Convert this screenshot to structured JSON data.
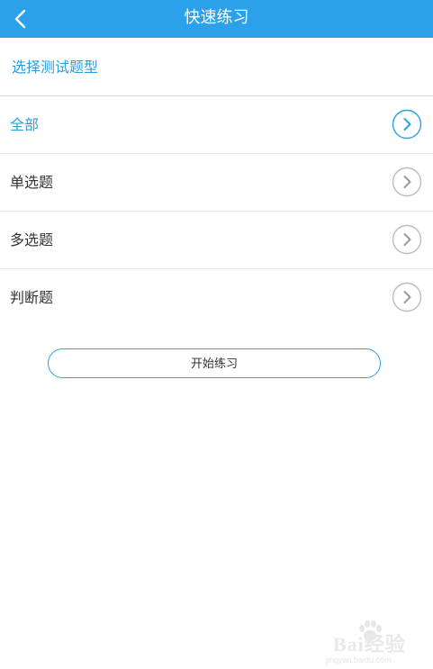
{
  "header": {
    "title": "快速练习",
    "back_icon": "back-arrow-icon",
    "bg_color": "#2aa1e9"
  },
  "section": {
    "title": "选择测试题型"
  },
  "question_types": {
    "items": [
      {
        "label": "全部",
        "selected": true
      },
      {
        "label": "单选题",
        "selected": false
      },
      {
        "label": "多选题",
        "selected": false
      },
      {
        "label": "判断题",
        "selected": false
      }
    ],
    "chevron_icon": "chevron-right-circle-icon",
    "selected_color": "#2a9fdc",
    "unselected_color": "#333333"
  },
  "actions": {
    "start_label": "开始练习"
  },
  "watermark": {
    "text": "Bai经验",
    "url_text": "jingyan.baidu.com"
  }
}
